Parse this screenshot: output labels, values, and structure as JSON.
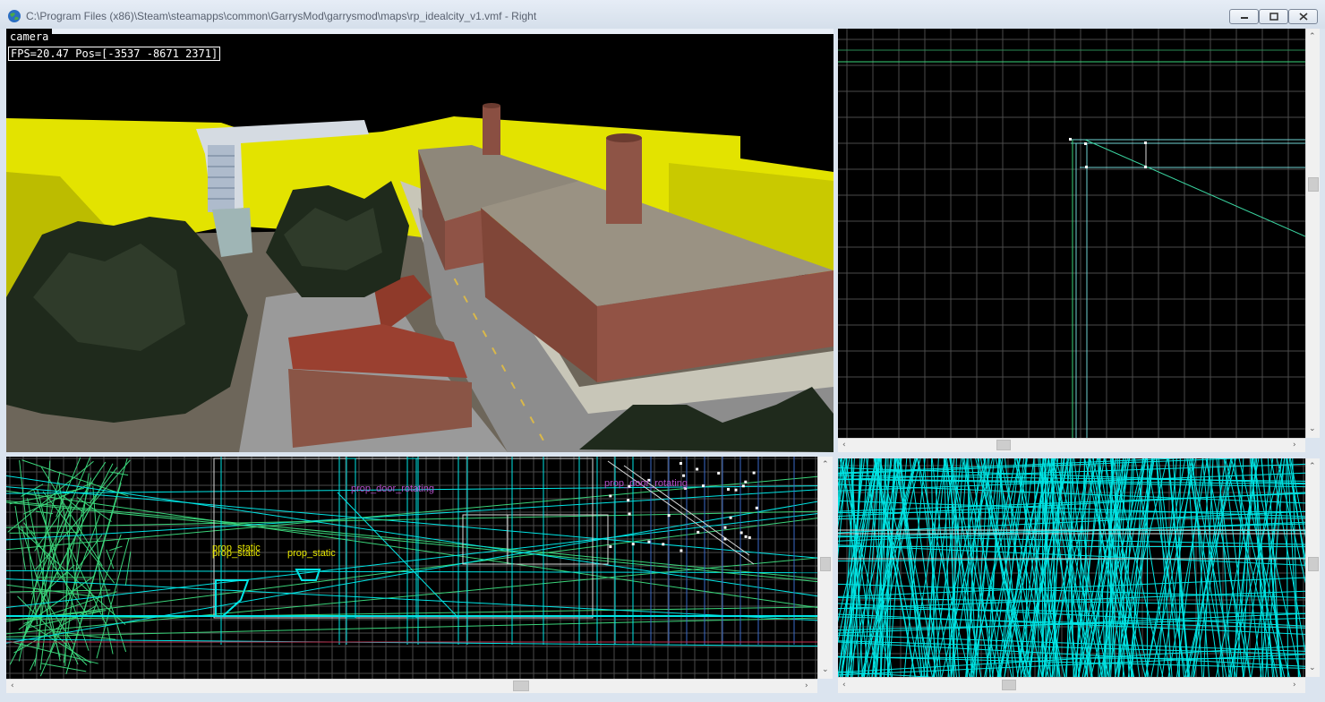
{
  "window": {
    "title": "C:\\Program Files (x86)\\Steam\\steamapps\\common\\GarrysMod\\garrysmod\\maps\\rp_idealcity_v1.vmf - Right"
  },
  "camera_view": {
    "label": "camera",
    "fps_readout": "FPS=20.47 Pos=[-3537 -8671 2371]"
  },
  "side_view": {
    "entity_labels": [
      "prop_door_rotating",
      "prop_door_rotating",
      "prop_static",
      "prop_static",
      "prop_static"
    ]
  },
  "icons": {
    "app": "hammer-globe-icon",
    "minimize": "minimize-icon",
    "maximize": "maximize-icon",
    "close": "close-icon"
  },
  "colors": {
    "grid": "#4a4a4a",
    "grid_major": "#6a6a6a",
    "wire_cyan": "#00e5e5",
    "wire_green": "#3ad47a",
    "entity_yellow": "#e6e600",
    "entity_magenta": "#b44ec8"
  }
}
